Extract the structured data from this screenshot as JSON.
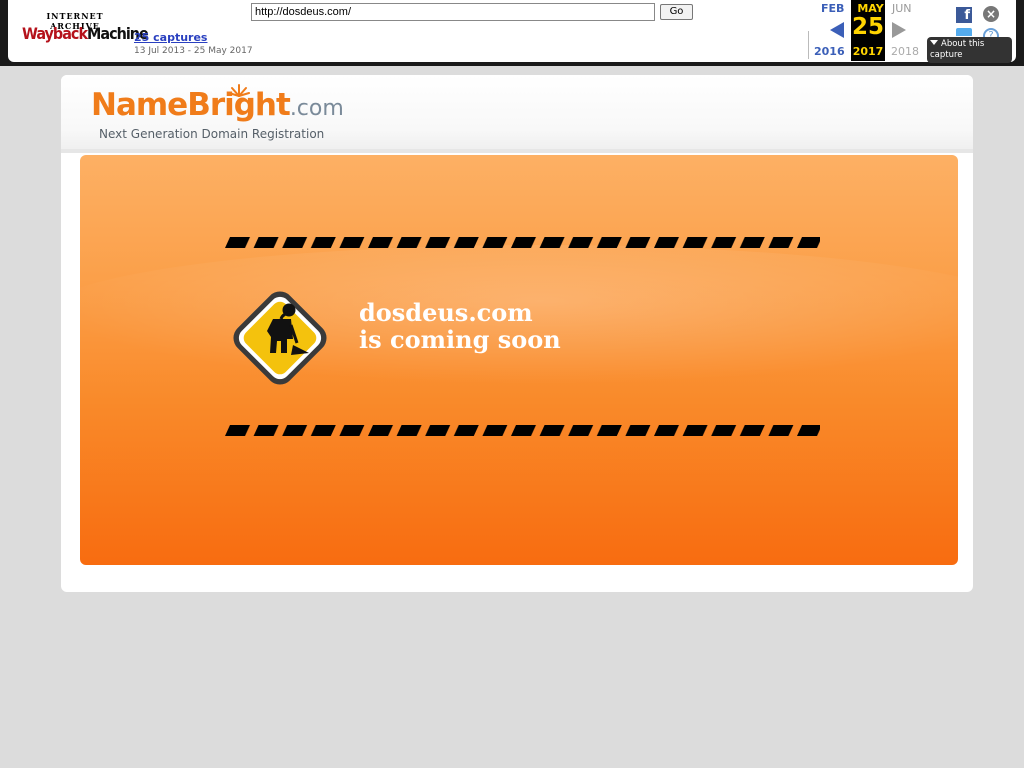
{
  "wayback": {
    "logo_top": "INTERNET ARCHIVE",
    "logo_wayback": "WaybackMachine",
    "url": "http://dosdeus.com/",
    "go_label": "Go",
    "captures_link": "25 captures",
    "date_range": "13 Jul 2013 - 25 May 2017",
    "months": {
      "prev": "FEB",
      "current": "MAY",
      "next": "JUN"
    },
    "day": "25",
    "years": {
      "prev": "2016",
      "current": "2017",
      "next": "2018"
    },
    "about_label": "About this capture",
    "icons": {
      "facebook": "facebook-icon",
      "twitter": "twitter-icon",
      "close": "close-icon",
      "help": "help-icon",
      "prev": "arrow-left-icon",
      "next": "arrow-right-icon"
    },
    "colors": {
      "accent": "#3b5fb8",
      "highlight": "#ffd400"
    }
  },
  "site": {
    "brand_name": "NameBright",
    "brand_tld": ".com",
    "tagline": "Next Generation Domain Registration",
    "headline_domain": "dosdeus.com",
    "headline_text": "is coming soon",
    "sign_icon": "construction-worker-icon",
    "colors": {
      "brand_orange": "#f07c1a",
      "panel_orange": "#f98a2a"
    }
  }
}
